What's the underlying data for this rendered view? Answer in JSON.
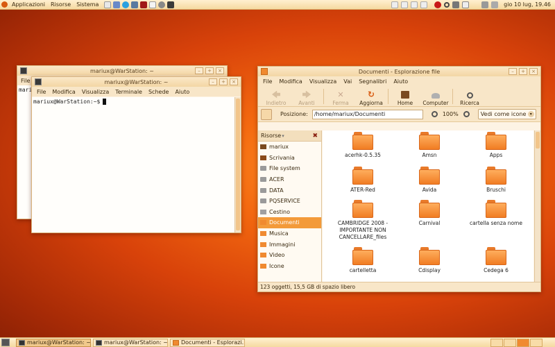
{
  "top_panel": {
    "menus": [
      "Applicazioni",
      "Risorse",
      "Sistema"
    ],
    "clock": "gio 10 lug, 19.46",
    "launcher_icons": [
      "text-editor-icon",
      "mail-icon",
      "skype-icon",
      "network-icon",
      "terminal-icon",
      "document-icon",
      "settings-icon",
      "media-icon"
    ],
    "tray_icons": [
      "window-list-icon",
      "window-list-icon",
      "window-list-icon",
      "window-list-icon",
      "monitor-icon",
      "search-icon",
      "power-icon",
      "calculator-icon",
      "volume-icon",
      "network-status-icon"
    ]
  },
  "terminal_back": {
    "title": "mariux@WarStation: ~",
    "menu_file": "File",
    "text_fragment": "mari"
  },
  "terminal_front": {
    "title": "mariux@WarStation: ~",
    "menus": [
      "File",
      "Modifica",
      "Visualizza",
      "Terminale",
      "Schede",
      "Aiuto"
    ],
    "prompt": "mariux@WarStation:~$"
  },
  "nautilus": {
    "title": "Documenti - Esplorazione file",
    "menus": [
      "File",
      "Modifica",
      "Visualizza",
      "Vai",
      "Segnalibri",
      "Aiuto"
    ],
    "toolbar": {
      "back": "Indietro",
      "forward": "Avanti",
      "stop": "Ferma",
      "reload": "Aggiorna",
      "home": "Home",
      "computer": "Computer",
      "search": "Ricerca"
    },
    "location_label": "Posizione:",
    "location_value": "/home/mariux/Documenti",
    "zoom": "100%",
    "view_mode": "Vedi come icone",
    "sidebar_header": "Risorse",
    "sidebar_items": [
      {
        "label": "mariux",
        "icon": "home-folder-icon",
        "selected": false
      },
      {
        "label": "Scrivania",
        "icon": "desktop-icon",
        "selected": false
      },
      {
        "label": "File system",
        "icon": "drive-icon",
        "selected": false
      },
      {
        "label": "ACER",
        "icon": "drive-icon",
        "selected": false
      },
      {
        "label": "DATA",
        "icon": "drive-icon",
        "selected": false
      },
      {
        "label": "PQSERVICE",
        "icon": "drive-icon",
        "selected": false
      },
      {
        "label": "Cestino",
        "icon": "trash-icon",
        "selected": false
      },
      {
        "label": "Documenti",
        "icon": "folder-icon",
        "selected": true
      },
      {
        "label": "Musica",
        "icon": "folder-icon",
        "selected": false
      },
      {
        "label": "Immagini",
        "icon": "folder-icon",
        "selected": false
      },
      {
        "label": "Video",
        "icon": "folder-icon",
        "selected": false
      },
      {
        "label": "Icone",
        "icon": "folder-icon",
        "selected": false
      }
    ],
    "files": [
      "acerhk-0.5.35",
      "Amsn",
      "Apps",
      "ATER-Red",
      "Avida",
      "Bruschi",
      "CAMBRIDGE 2008 - IMPORTANTE NON CANCELLARE_files",
      "Carnival",
      "cartella senza nome",
      "cartelletta",
      "Cdisplay",
      "Cedega 6"
    ],
    "status": "123 oggetti, 15,5 GB di spazio libero"
  },
  "taskbar": {
    "tasks": [
      {
        "label": "mariux@WarStation: ~",
        "active": true
      },
      {
        "label": "mariux@WarStation: ~",
        "active": false
      },
      {
        "label": "Documenti - Esplorazi...",
        "active": false
      }
    ],
    "workspaces": 4
  }
}
